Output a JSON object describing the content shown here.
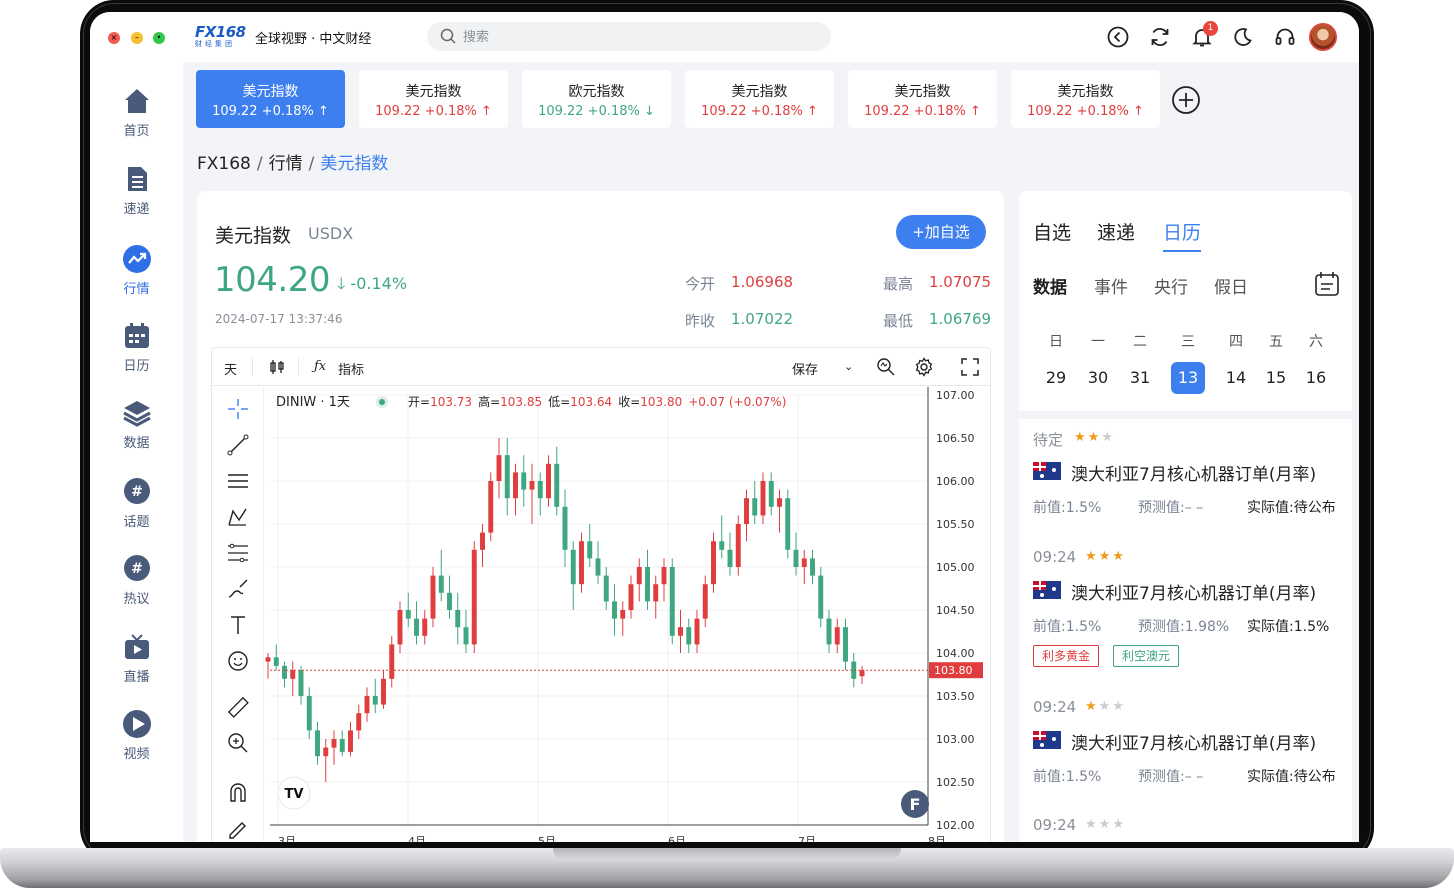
{
  "app": {
    "logo_text": "FX168",
    "logo_sub": "财经集团",
    "slogan": "全球视野 · 中文财经",
    "notifications": "1"
  },
  "search": {
    "placeholder": "搜索",
    "icon": "search-icon"
  },
  "sidebar": {
    "items": [
      {
        "label": "首页",
        "icon": "home-icon"
      },
      {
        "label": "速递",
        "icon": "document-icon"
      },
      {
        "label": "行情",
        "icon": "trend-icon",
        "active": true
      },
      {
        "label": "日历",
        "icon": "calendar-icon"
      },
      {
        "label": "数据",
        "icon": "layers-icon"
      },
      {
        "label": "话题",
        "icon": "hashtag-icon"
      },
      {
        "label": "热议",
        "icon": "hashtag-icon"
      },
      {
        "label": "直播",
        "icon": "tv-icon"
      },
      {
        "label": "视频",
        "icon": "play-icon"
      }
    ]
  },
  "index_tabs": [
    {
      "name": "美元指数",
      "value": "109.22  +0.18%",
      "dir": "up",
      "active": true
    },
    {
      "name": "美元指数",
      "value": "109.22  +0.18%",
      "dir": "up"
    },
    {
      "name": "欧元指数",
      "value": "109.22  +0.18%",
      "dir": "down"
    },
    {
      "name": "美元指数",
      "value": "109.22  +0.18%",
      "dir": "up"
    },
    {
      "name": "美元指数",
      "value": "109.22  +0.18%",
      "dir": "up"
    },
    {
      "name": "美元指数",
      "value": "109.22  +0.18%",
      "dir": "up"
    }
  ],
  "breadcrumb": {
    "root": "FX168",
    "section": "行情",
    "current": "美元指数",
    "sep": "/"
  },
  "quote": {
    "name": "美元指数",
    "code": "USDX",
    "add_label": "+加自选",
    "price": "104.20",
    "change": "-0.14%",
    "datetime": "2024-07-17  13:37:46",
    "open_label": "今开",
    "open": "1.06968",
    "high_label": "最高",
    "high": "1.07075",
    "prev_label": "昨收",
    "prev": "1.07022",
    "low_label": "最低",
    "low": "1.06769"
  },
  "chart_toolbar": {
    "interval": "天",
    "indicators": "指标",
    "save": "保存"
  },
  "chart_legend": {
    "symbol": "DINIW · 1天",
    "o_label": "开=",
    "o": "103.73",
    "h_label": "高=",
    "h": "103.85",
    "l_label": "低=",
    "l": "103.64",
    "c_label": "收=",
    "c": "103.80",
    "chg": "+0.07 (+0.07%)"
  },
  "chart_data": {
    "type": "candlestick",
    "yticks": [
      "107.00",
      "106.50",
      "106.00",
      "105.50",
      "105.00",
      "104.50",
      "104.00",
      "103.50",
      "103.00",
      "102.50",
      "102.00"
    ],
    "ylim": [
      102.0,
      107.0
    ],
    "xticks": [
      "3月",
      "4月",
      "5月",
      "6月",
      "7月",
      "8月"
    ],
    "last_price": "103.80",
    "up_color": "#e03e3e",
    "down_color": "#3fa77f",
    "candles": [
      [
        103.9,
        104.0,
        103.7,
        103.95
      ],
      [
        103.95,
        104.1,
        103.8,
        103.85
      ],
      [
        103.85,
        103.9,
        103.6,
        103.7
      ],
      [
        103.7,
        103.9,
        103.5,
        103.8
      ],
      [
        103.8,
        103.85,
        103.4,
        103.5
      ],
      [
        103.5,
        103.6,
        103.0,
        103.1
      ],
      [
        103.1,
        103.2,
        102.7,
        102.8
      ],
      [
        102.8,
        103.0,
        102.5,
        102.9
      ],
      [
        102.9,
        103.1,
        102.7,
        103.0
      ],
      [
        103.0,
        103.1,
        102.8,
        102.85
      ],
      [
        102.85,
        103.2,
        102.8,
        103.1
      ],
      [
        103.1,
        103.4,
        103.0,
        103.3
      ],
      [
        103.3,
        103.6,
        103.2,
        103.5
      ],
      [
        103.5,
        103.7,
        103.3,
        103.4
      ],
      [
        103.4,
        103.8,
        103.35,
        103.7
      ],
      [
        103.7,
        104.2,
        103.6,
        104.1
      ],
      [
        104.1,
        104.6,
        104.0,
        104.5
      ],
      [
        104.5,
        104.7,
        104.3,
        104.4
      ],
      [
        104.4,
        104.6,
        104.1,
        104.2
      ],
      [
        104.2,
        104.5,
        104.1,
        104.4
      ],
      [
        104.4,
        105.0,
        104.3,
        104.9
      ],
      [
        104.9,
        105.2,
        104.6,
        104.7
      ],
      [
        104.7,
        104.9,
        104.4,
        104.5
      ],
      [
        104.5,
        104.7,
        104.1,
        104.3
      ],
      [
        104.3,
        104.5,
        104.0,
        104.1
      ],
      [
        104.1,
        105.3,
        104.0,
        105.2
      ],
      [
        105.2,
        105.5,
        105.0,
        105.4
      ],
      [
        105.4,
        106.1,
        105.3,
        106.0
      ],
      [
        106.0,
        106.5,
        105.8,
        106.3
      ],
      [
        106.3,
        106.5,
        105.6,
        105.8
      ],
      [
        105.8,
        106.2,
        105.6,
        106.1
      ],
      [
        106.1,
        106.3,
        105.7,
        105.9
      ],
      [
        105.9,
        106.2,
        105.5,
        106.0
      ],
      [
        106.0,
        106.1,
        105.6,
        105.8
      ],
      [
        105.8,
        106.3,
        105.7,
        106.2
      ],
      [
        106.2,
        106.4,
        105.6,
        105.7
      ],
      [
        105.7,
        105.9,
        105.0,
        105.2
      ],
      [
        105.2,
        105.3,
        104.5,
        104.8
      ],
      [
        104.8,
        105.4,
        104.7,
        105.3
      ],
      [
        105.3,
        105.5,
        105.0,
        105.1
      ],
      [
        105.1,
        105.3,
        104.8,
        104.9
      ],
      [
        104.9,
        105.0,
        104.5,
        104.6
      ],
      [
        104.6,
        104.8,
        104.2,
        104.4
      ],
      [
        104.4,
        104.6,
        104.2,
        104.5
      ],
      [
        104.5,
        104.9,
        104.4,
        104.8
      ],
      [
        104.8,
        105.1,
        104.6,
        105.0
      ],
      [
        105.0,
        105.2,
        104.5,
        104.6
      ],
      [
        104.6,
        104.9,
        104.4,
        104.8
      ],
      [
        104.8,
        105.1,
        104.6,
        105.0
      ],
      [
        105.0,
        105.1,
        104.1,
        104.2
      ],
      [
        104.2,
        104.5,
        104.0,
        104.3
      ],
      [
        104.3,
        104.4,
        104.0,
        104.1
      ],
      [
        104.1,
        104.5,
        104.0,
        104.4
      ],
      [
        104.4,
        104.9,
        104.3,
        104.8
      ],
      [
        104.8,
        105.4,
        104.7,
        105.3
      ],
      [
        105.3,
        105.6,
        105.1,
        105.2
      ],
      [
        105.2,
        105.4,
        104.9,
        105.0
      ],
      [
        105.0,
        105.6,
        104.9,
        105.5
      ],
      [
        105.5,
        105.9,
        105.3,
        105.8
      ],
      [
        105.8,
        106.0,
        105.5,
        105.6
      ],
      [
        105.6,
        106.1,
        105.5,
        106.0
      ],
      [
        106.0,
        106.1,
        105.6,
        105.7
      ],
      [
        105.7,
        105.9,
        105.4,
        105.8
      ],
      [
        105.8,
        105.9,
        105.1,
        105.2
      ],
      [
        105.2,
        105.4,
        104.9,
        105.0
      ],
      [
        105.0,
        105.2,
        104.8,
        105.1
      ],
      [
        105.1,
        105.2,
        104.8,
        104.9
      ],
      [
        104.9,
        105.0,
        104.3,
        104.4
      ],
      [
        104.4,
        104.5,
        104.0,
        104.1
      ],
      [
        104.1,
        104.4,
        104.0,
        104.3
      ],
      [
        104.3,
        104.4,
        103.8,
        103.9
      ],
      [
        103.9,
        104.0,
        103.6,
        103.7
      ],
      [
        103.73,
        103.85,
        103.64,
        103.8
      ]
    ]
  },
  "right_panel": {
    "tabs": [
      "自选",
      "速递",
      "日历"
    ],
    "active_tab": 2,
    "sub_tabs": [
      "数据",
      "事件",
      "央行",
      "假日"
    ],
    "weekdays": [
      "日",
      "一",
      "二",
      "三",
      "四",
      "五",
      "六"
    ],
    "days": [
      "29",
      "30",
      "31",
      "13",
      "14",
      "15",
      "16"
    ],
    "active_day": 3,
    "events": [
      {
        "time": "待定",
        "stars": 2,
        "title": "澳大利亚7月核心机器订单(月率)",
        "prev": "前值:1.5%",
        "forecast": "预测值:– –",
        "actual": "实际值:待公布",
        "tags": []
      },
      {
        "time": "09:24",
        "stars": 3,
        "title": "澳大利亚7月核心机器订单(月率)",
        "prev": "前值:1.5%",
        "forecast": "预测值:1.98%",
        "actual": "实际值:1.5%",
        "tags": [
          {
            "text": "利多黄金",
            "color": "red"
          },
          {
            "text": "利空澳元",
            "color": "green"
          }
        ]
      },
      {
        "time": "09:24",
        "stars": 1,
        "title": "澳大利亚7月核心机器订单(月率)",
        "prev": "前值:1.5%",
        "forecast": "预测值:– –",
        "actual": "实际值:待公布",
        "tags": []
      },
      {
        "time": "09:24",
        "stars": 0,
        "title": "",
        "prev": "",
        "forecast": "",
        "actual": "",
        "tags": []
      }
    ]
  }
}
